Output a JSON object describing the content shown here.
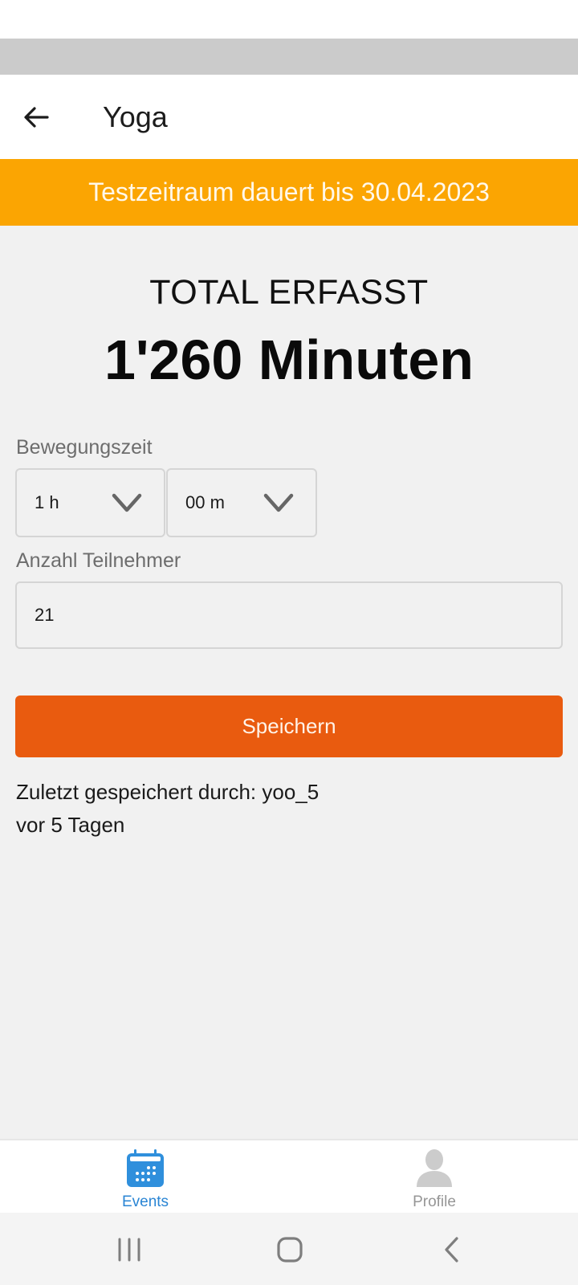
{
  "app_bar": {
    "title": "Yoga",
    "back_icon": "arrow-left-icon"
  },
  "trial_banner": {
    "text": "Testzeitraum dauert bis 30.04.2023",
    "color": "#fba502"
  },
  "summary": {
    "label": "TOTAL ERFASST",
    "value": "1'260 Minuten"
  },
  "form": {
    "duration_label": "Bewegungszeit",
    "hours_select": {
      "value": "1 h",
      "icon": "chevron-down-icon"
    },
    "minutes_select": {
      "value": "00 m",
      "icon": "chevron-down-icon"
    },
    "participants_label": "Anzahl Teilnehmer",
    "participants_value": "21",
    "save_label": "Speichern",
    "save_color": "#e95b0f"
  },
  "last_saved": {
    "by_line": "Zuletzt gespeichert durch: yoo_5",
    "when_line": "vor 5 Tagen"
  },
  "bottom_nav": {
    "items": [
      {
        "label": "Events",
        "icon": "calendar-icon",
        "active": true,
        "color": "#2a85d4"
      },
      {
        "label": "Profile",
        "icon": "person-icon",
        "active": false,
        "color": "#969696"
      }
    ]
  },
  "system_nav": {
    "recents_icon": "recents-icon",
    "home_icon": "home-icon",
    "back_icon": "back-chevron-icon"
  }
}
